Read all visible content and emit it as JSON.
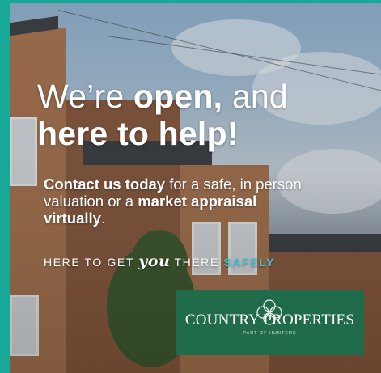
{
  "headline": {
    "line1_light": "We’re ",
    "line1_bold": "open,",
    "line1_end": " and",
    "line2_bold": "here to help!"
  },
  "body": {
    "part1_bold": "Contact us today",
    "part2": " for a safe, in person valuation or a ",
    "part3_bold": "market appraisal virtually",
    "part4": "."
  },
  "tagline": {
    "part1": "HERE TO GET ",
    "script_word": "you",
    "part2": " THERE ",
    "accent_word": "SAFELY"
  },
  "logo": {
    "name": "COUNTRY PROPERTIES",
    "subtitle": "PART OF HUNTERS"
  },
  "colors": {
    "frame": "#18a898",
    "logo_bg": "#1f6b4a",
    "accent": "#3ec6d8"
  }
}
